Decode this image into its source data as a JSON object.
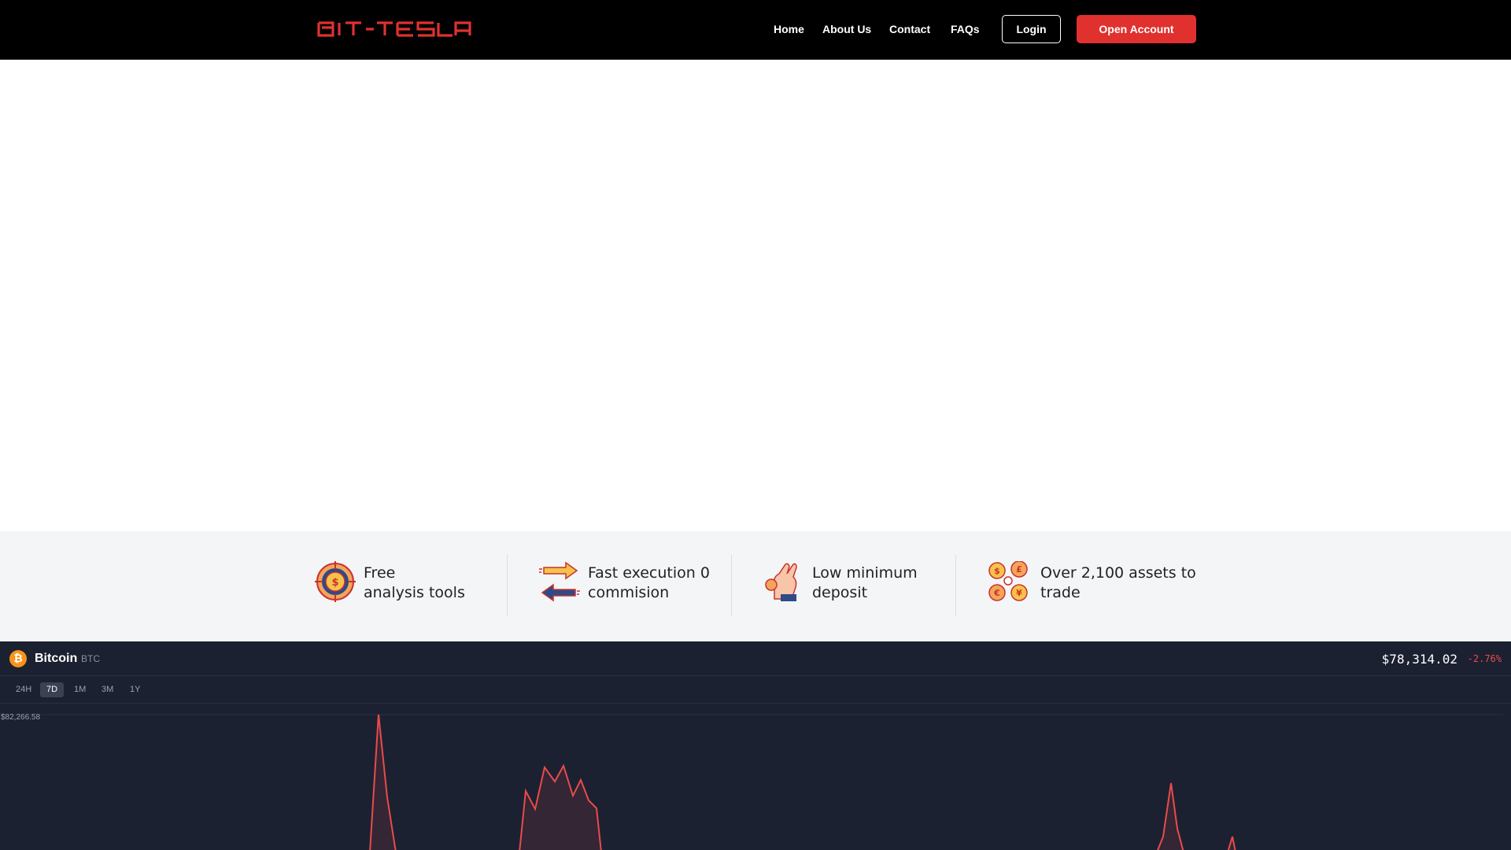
{
  "header": {
    "logo_text": "BIT-TESLA",
    "nav": [
      {
        "label": "Home"
      },
      {
        "label": "About Us"
      },
      {
        "label": "Contact"
      },
      {
        "label": "FAQs"
      }
    ],
    "login_label": "Login",
    "open_account_label": "Open Account"
  },
  "features": [
    {
      "line1": "Free",
      "line2": "analysis tools",
      "icon": "target-dollar-icon"
    },
    {
      "line1": "Fast execution 0",
      "line2": "commision",
      "icon": "exchange-arrows-icon"
    },
    {
      "line1": "Low minimum",
      "line2": "deposit",
      "icon": "hand-coin-icon"
    },
    {
      "line1": "Over 2,100 assets to",
      "line2": "trade",
      "icon": "currency-coins-icon"
    }
  ],
  "ticker": {
    "coin_name": "Bitcoin",
    "coin_symbol": "BTC",
    "coin_icon_glyph": "₿",
    "price": "$78,314.02",
    "change": "-2.76%",
    "ranges": [
      "24H",
      "7D",
      "1M",
      "3M",
      "1Y"
    ],
    "active_range": "7D",
    "max_label": "$82,266.58"
  },
  "colors": {
    "brand_red": "#e0312f",
    "header_bg": "#000000",
    "features_bg": "#f4f5f7",
    "ticker_bg": "#1c2131",
    "negative": "#e94b4b"
  }
}
